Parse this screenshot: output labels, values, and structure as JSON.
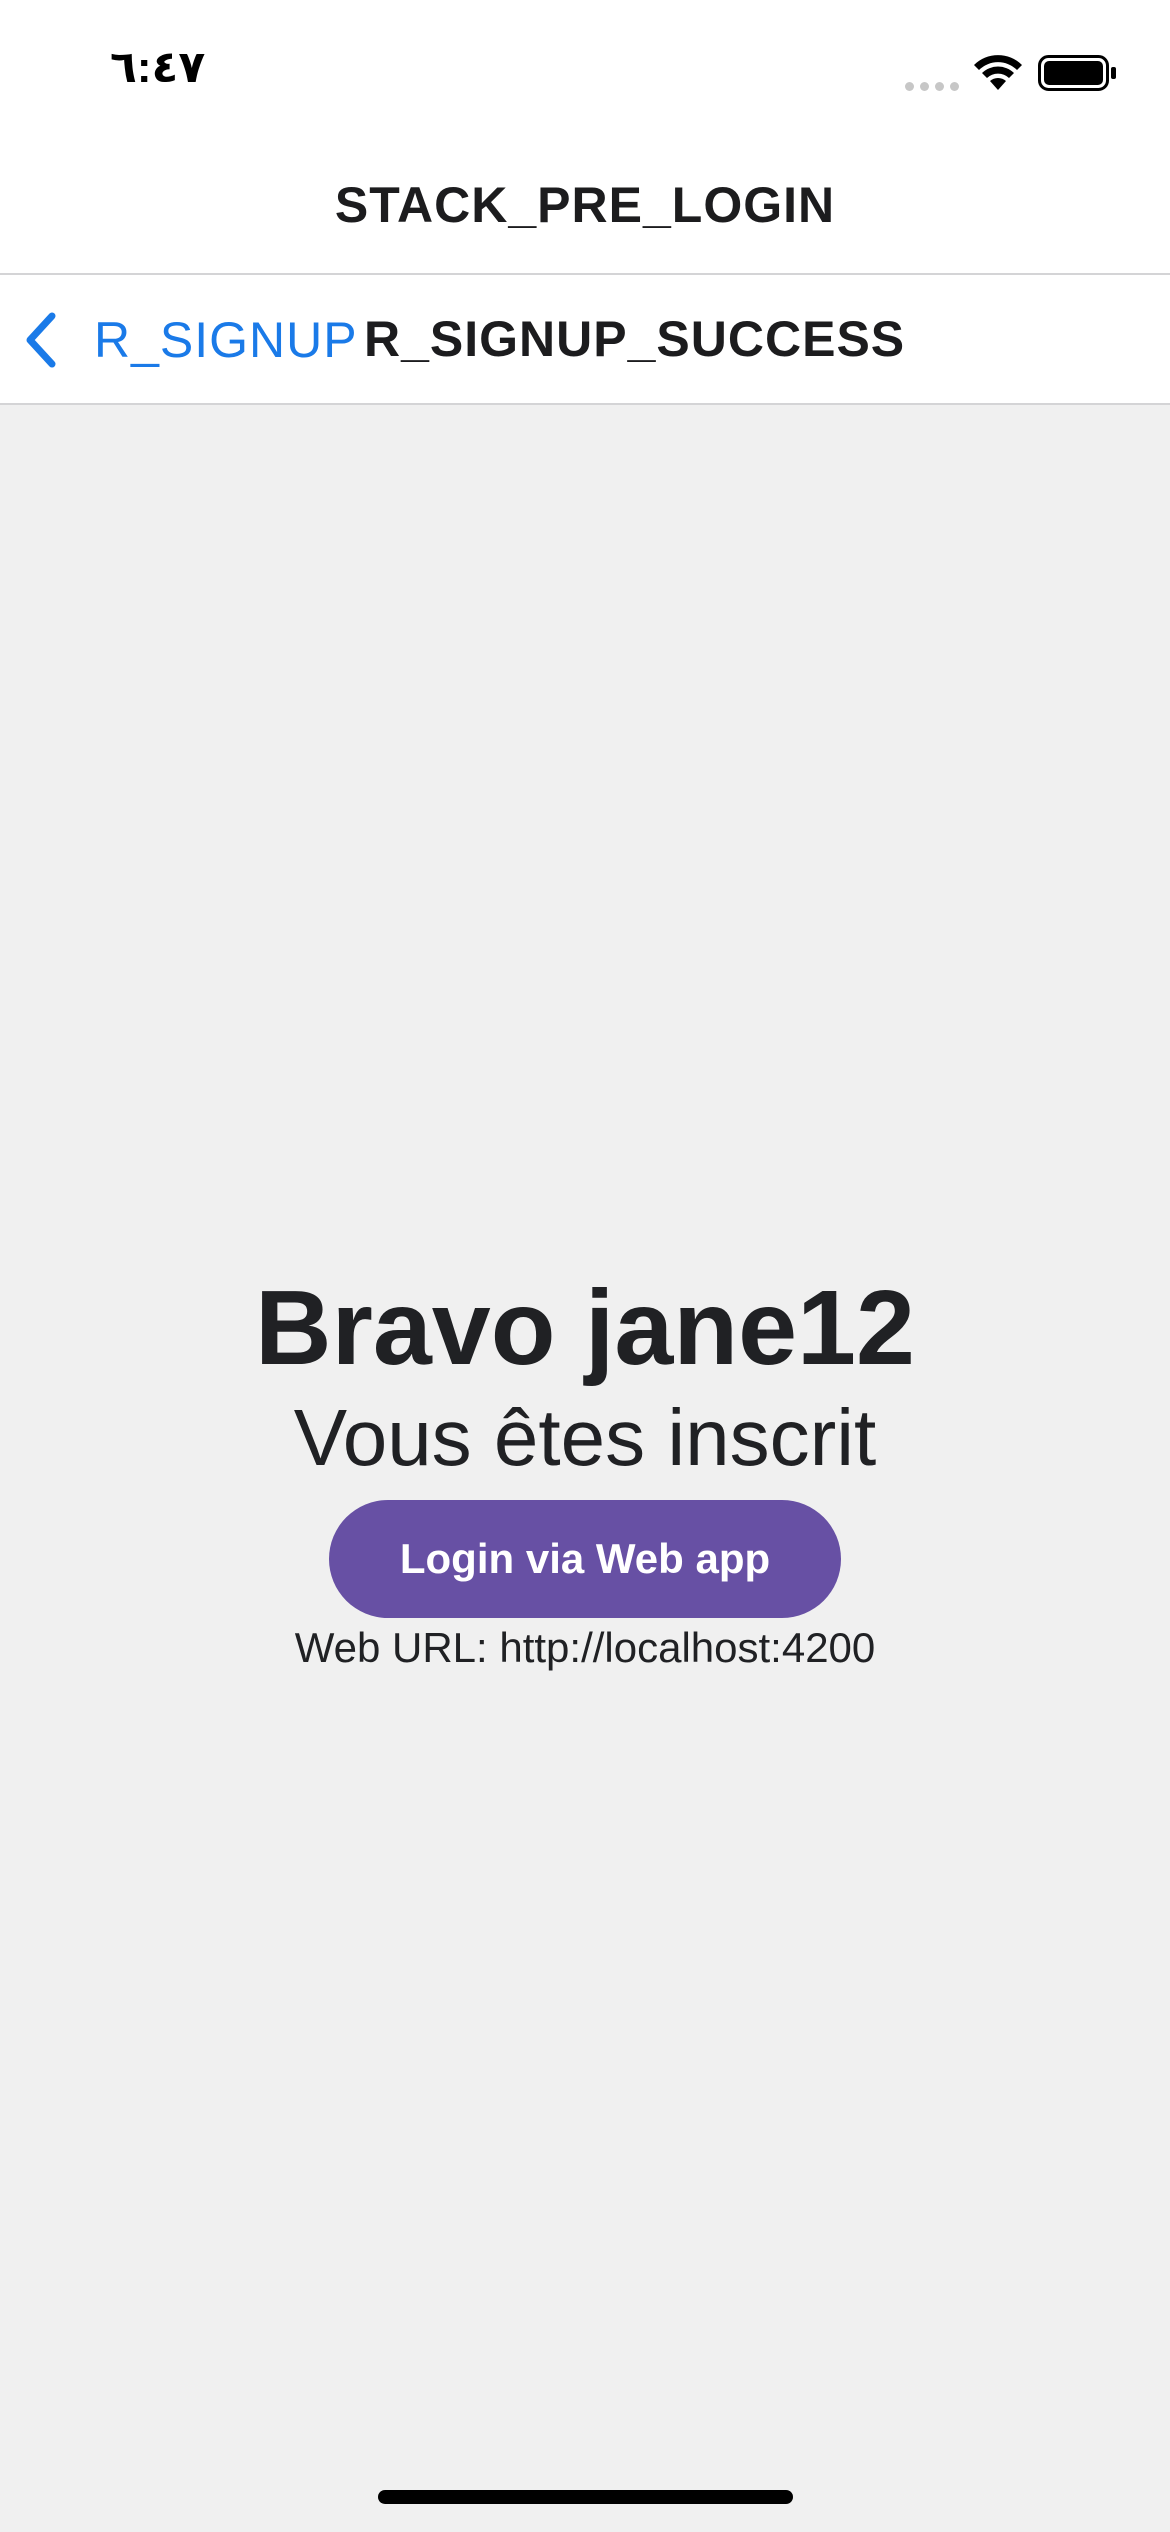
{
  "status_bar": {
    "time": "٦:٤٧",
    "wifi_icon": "wifi-icon",
    "battery_icon": "battery-icon"
  },
  "outer_header": {
    "title": "STACK_PRE_LOGIN"
  },
  "inner_header": {
    "back_label": "R_SIGNUP",
    "back_icon": "chevron-left-icon",
    "title": "R_SIGNUP_SUCCESS"
  },
  "main": {
    "greeting": "Bravo jane12",
    "subtitle": "Vous êtes inscrit",
    "login_button_label": "Login via Web app",
    "web_url": "Web URL: http://localhost:4200"
  },
  "colors": {
    "accent_blue": "#1a7ae8",
    "button_purple": "#6750a4",
    "background": "#f0f0f0"
  }
}
